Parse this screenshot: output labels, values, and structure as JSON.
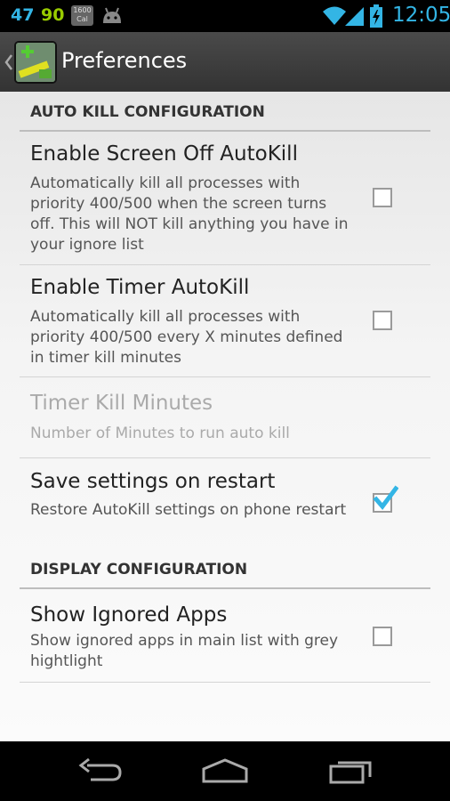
{
  "status_bar": {
    "notif_1": "47",
    "notif_2": "90",
    "cal_top": "1600",
    "cal_bottom": "Cal",
    "time": "12:05"
  },
  "action_bar": {
    "title": "Preferences"
  },
  "sections": {
    "auto_kill": "AUTO KILL CONFIGURATION",
    "display": "DISPLAY CONFIGURATION"
  },
  "prefs": {
    "screen_off": {
      "title": "Enable Screen Off AutoKill",
      "summary": "Automatically kill all processes with priority 400/500 when the screen turns off. This will NOT kill anything you have in your ignore list",
      "checked": false
    },
    "timer": {
      "title": "Enable Timer AutoKill",
      "summary": "Automatically kill all processes with priority 400/500 every X minutes defined in timer kill minutes",
      "checked": false
    },
    "timer_minutes": {
      "title": "Timer Kill Minutes",
      "summary": "Number of Minutes to run auto kill",
      "enabled": false
    },
    "save_settings": {
      "title": "Save settings on restart",
      "summary": "Restore AutoKill settings on phone restart",
      "checked": true
    },
    "show_ignored": {
      "title": "Show Ignored Apps",
      "summary": "Show ignored apps in main list with grey hightlight",
      "checked": false
    }
  },
  "colors": {
    "accent": "#33b5e5",
    "accent_green": "#99cc00"
  },
  "icons": {
    "status": [
      "android-icon",
      "wifi-icon",
      "signal-icon",
      "battery-charging-icon"
    ],
    "nav": [
      "back-icon",
      "home-icon",
      "recents-icon"
    ]
  }
}
